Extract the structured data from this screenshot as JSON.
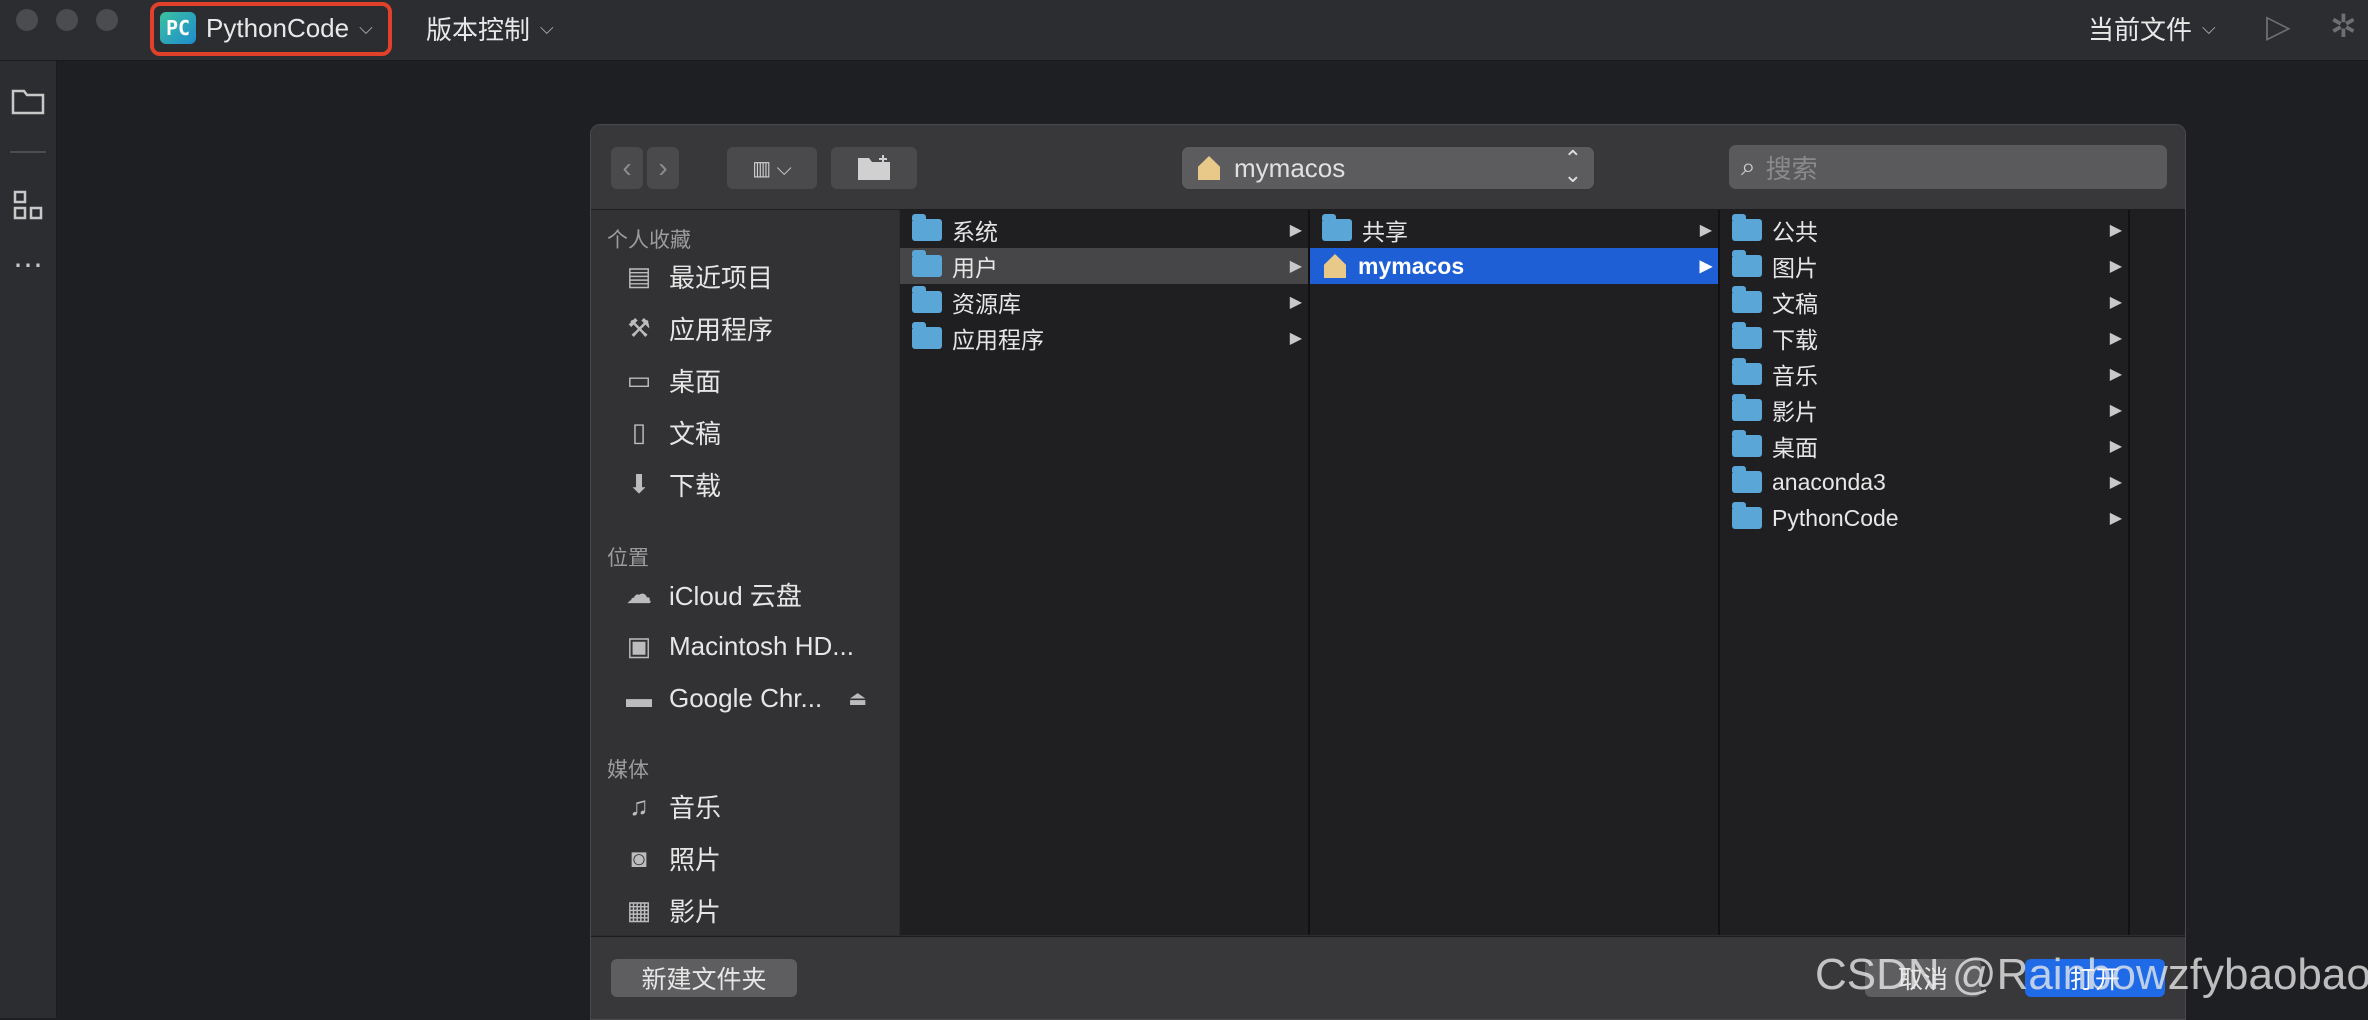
{
  "ide": {
    "project_name": "PythonCode",
    "project_logo": "PC",
    "vcs_label": "版本控制",
    "current_file_label": "当前文件",
    "run_icon": "run-icon",
    "debug_icon": "debug-icon",
    "highlight_color": "#e1402b"
  },
  "dialog": {
    "location": "mymacos",
    "search_placeholder": "搜索",
    "new_folder_label": "新建文件夹",
    "cancel_label": "取消",
    "open_label": "打开",
    "sidebar": {
      "favorites_header": "个人收藏",
      "favorites": [
        {
          "label": "最近项目",
          "icon": "recents-icon"
        },
        {
          "label": "应用程序",
          "icon": "applications-icon"
        },
        {
          "label": "桌面",
          "icon": "desktop-icon"
        },
        {
          "label": "文稿",
          "icon": "documents-icon"
        },
        {
          "label": "下载",
          "icon": "downloads-icon"
        }
      ],
      "locations_header": "位置",
      "locations": [
        {
          "label": "iCloud 云盘",
          "icon": "icloud-icon"
        },
        {
          "label": "Macintosh HD...",
          "icon": "disk-icon"
        },
        {
          "label": "Google Chr...",
          "icon": "drive-icon"
        }
      ],
      "media_header": "媒体",
      "media": [
        {
          "label": "音乐",
          "icon": "music-icon"
        },
        {
          "label": "照片",
          "icon": "photos-icon"
        },
        {
          "label": "影片",
          "icon": "movies-icon"
        }
      ]
    },
    "columns": [
      [
        "系统",
        "用户",
        "资源库",
        "应用程序"
      ],
      [
        "共享",
        "mymacos"
      ],
      [
        "公共",
        "图片",
        "文稿",
        "下载",
        "音乐",
        "影片",
        "桌面",
        "anaconda3",
        "PythonCode"
      ]
    ],
    "selected": {
      "column_1": "用户",
      "column_2": "mymacos",
      "highlighted": "PythonCode"
    },
    "accent_color": "#1f5fd6"
  },
  "watermark": "CSDN @Rainbowzfybaobao"
}
